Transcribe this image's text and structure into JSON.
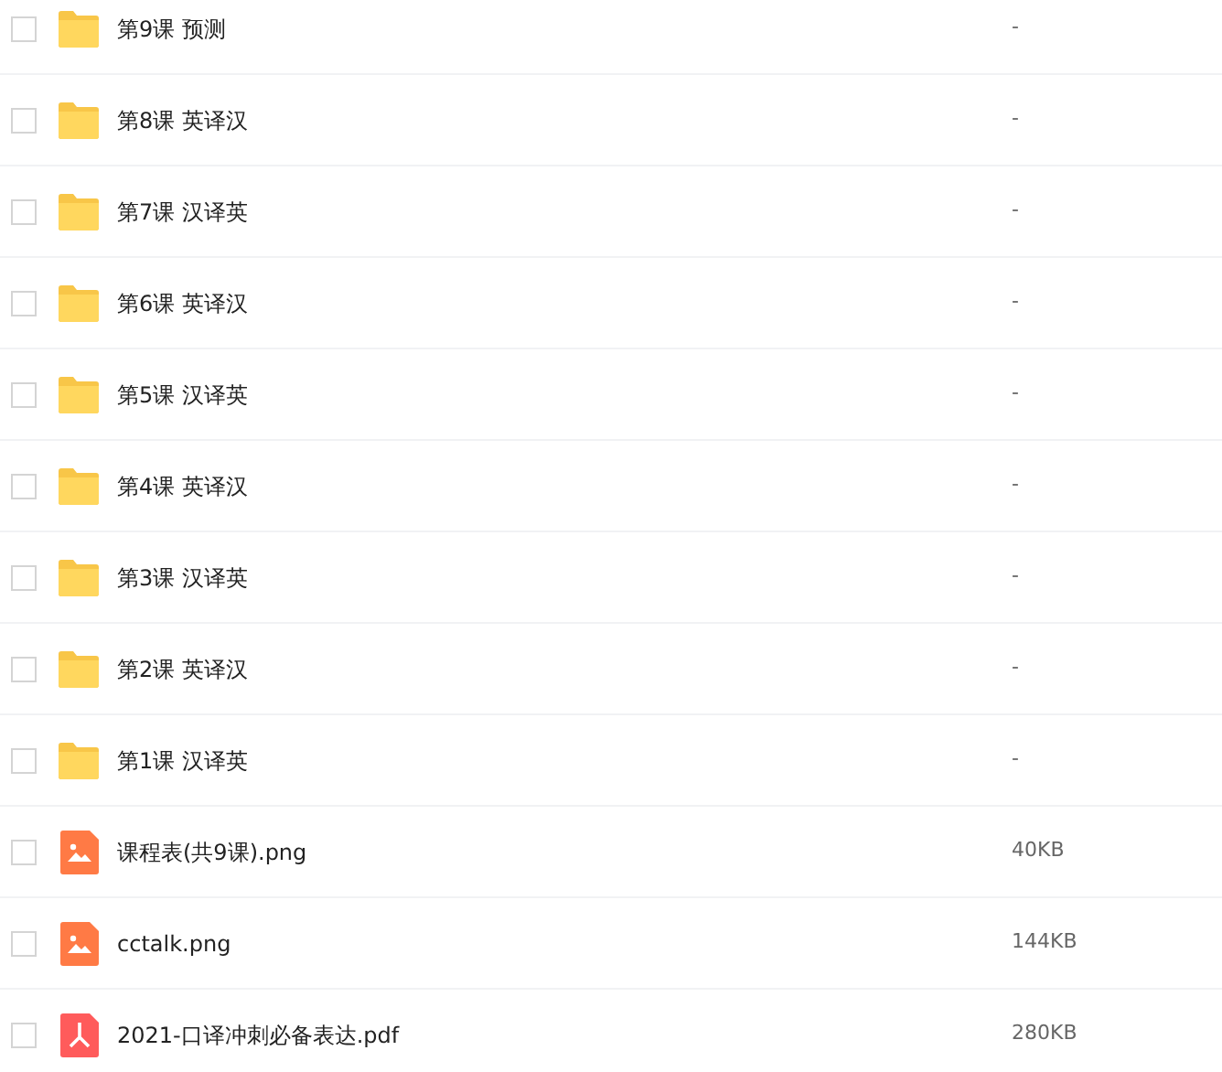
{
  "files": [
    {
      "kind": "folder",
      "name": "第9课 预测",
      "size": "-",
      "checked": false
    },
    {
      "kind": "folder",
      "name": "第8课 英译汉",
      "size": "-",
      "checked": false
    },
    {
      "kind": "folder",
      "name": "第7课 汉译英",
      "size": "-",
      "checked": false
    },
    {
      "kind": "folder",
      "name": "第6课 英译汉",
      "size": "-",
      "checked": false
    },
    {
      "kind": "folder",
      "name": "第5课 汉译英",
      "size": "-",
      "checked": false
    },
    {
      "kind": "folder",
      "name": "第4课 英译汉",
      "size": "-",
      "checked": false
    },
    {
      "kind": "folder",
      "name": "第3课 汉译英",
      "size": "-",
      "checked": false
    },
    {
      "kind": "folder",
      "name": "第2课 英译汉",
      "size": "-",
      "checked": false
    },
    {
      "kind": "folder",
      "name": "第1课 汉译英",
      "size": "-",
      "checked": false
    },
    {
      "kind": "image",
      "name": "课程表(共9课).png",
      "size": "40KB",
      "checked": false
    },
    {
      "kind": "image",
      "name": "cctalk.png",
      "size": "144KB",
      "checked": false
    },
    {
      "kind": "pdf",
      "name": "2021-口译冲刺必备表达.pdf",
      "size": "280KB",
      "checked": false
    }
  ]
}
